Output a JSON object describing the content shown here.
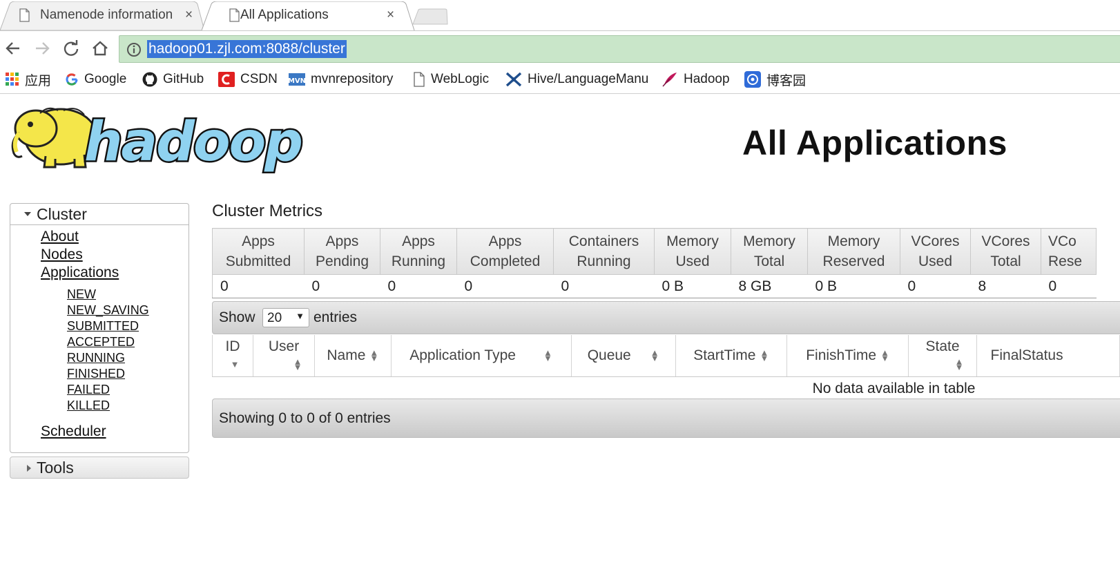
{
  "browser": {
    "tabs": [
      {
        "title": "Namenode information",
        "close": "×"
      },
      {
        "title": "All Applications",
        "close": "×"
      }
    ],
    "url": "hadoop01.zjl.com:8088/cluster",
    "bookmarks": [
      {
        "label": "应用",
        "icon": "apps-grid-icon"
      },
      {
        "label": "Google",
        "icon": "google-icon"
      },
      {
        "label": "GitHub",
        "icon": "github-icon"
      },
      {
        "label": "CSDN",
        "icon": "csdn-icon"
      },
      {
        "label": "mvnrepository",
        "icon": "mvn-icon"
      },
      {
        "label": "WebLogic",
        "icon": "page-icon"
      },
      {
        "label": "Hive/LanguageManu",
        "icon": "hive-icon"
      },
      {
        "label": "Hadoop",
        "icon": "feather-icon"
      },
      {
        "label": "博客园",
        "icon": "cnblogs-icon"
      }
    ]
  },
  "header": {
    "logo_text": "hadoop",
    "title": "All Applications"
  },
  "sidebar": {
    "cluster_label": "Cluster",
    "links": [
      "About",
      "Nodes",
      "Applications"
    ],
    "app_states": [
      "NEW",
      "NEW_SAVING",
      "SUBMITTED",
      "ACCEPTED",
      "RUNNING",
      "FINISHED",
      "FAILED",
      "KILLED"
    ],
    "scheduler": "Scheduler",
    "tools_label": "Tools"
  },
  "metrics": {
    "title": "Cluster Metrics",
    "columns": [
      {
        "h1": "Apps",
        "h2": "Submitted",
        "value": "0"
      },
      {
        "h1": "Apps",
        "h2": "Pending",
        "value": "0"
      },
      {
        "h1": "Apps",
        "h2": "Running",
        "value": "0"
      },
      {
        "h1": "Apps",
        "h2": "Completed",
        "value": "0"
      },
      {
        "h1": "Containers",
        "h2": "Running",
        "value": "0"
      },
      {
        "h1": "Memory",
        "h2": "Used",
        "value": "0 B"
      },
      {
        "h1": "Memory",
        "h2": "Total",
        "value": "8 GB"
      },
      {
        "h1": "Memory",
        "h2": "Reserved",
        "value": "0 B"
      },
      {
        "h1": "VCores",
        "h2": "Used",
        "value": "0"
      },
      {
        "h1": "VCores",
        "h2": "Total",
        "value": "8"
      },
      {
        "h1": "VCo",
        "h2": "Rese",
        "value": "0"
      }
    ]
  },
  "table_controls": {
    "show": "Show",
    "page_size": "20",
    "entries": "entries"
  },
  "apps_table": {
    "columns": [
      {
        "label": "ID",
        "sort": "desc"
      },
      {
        "label": "User",
        "sort": "both"
      },
      {
        "label": "Name",
        "sort": "both"
      },
      {
        "label": "Application Type",
        "sort": "both"
      },
      {
        "label": "Queue",
        "sort": "both"
      },
      {
        "label": "StartTime",
        "sort": "both"
      },
      {
        "label": "FinishTime",
        "sort": "both"
      },
      {
        "label": "State",
        "sort": "both"
      },
      {
        "label": "FinalStatus",
        "sort": "none"
      }
    ],
    "empty_message": "No data available in table",
    "footer": "Showing 0 to 0 of 0 entries"
  }
}
